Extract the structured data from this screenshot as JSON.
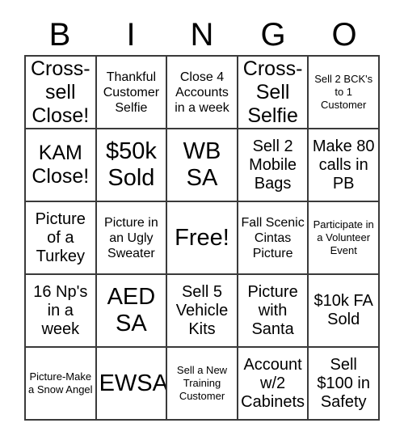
{
  "header": {
    "letters": [
      "B",
      "I",
      "N",
      "G",
      "O"
    ]
  },
  "grid": {
    "rows": [
      [
        {
          "text": "Cross-sell Close!",
          "size": "lg"
        },
        {
          "text": "Thankful Customer Selfie",
          "size": "sm"
        },
        {
          "text": "Close 4 Accounts in a week",
          "size": "sm"
        },
        {
          "text": "Cross-Sell Selfie",
          "size": "lg"
        },
        {
          "text": "Sell 2 BCK's to 1 Customer",
          "size": "xs"
        }
      ],
      [
        {
          "text": "KAM Close!",
          "size": "lg"
        },
        {
          "text": "$50k Sold",
          "size": "xl"
        },
        {
          "text": "WB SA",
          "size": "xl"
        },
        {
          "text": "Sell 2 Mobile Bags",
          "size": "md"
        },
        {
          "text": "Make 80 calls in PB",
          "size": "md"
        }
      ],
      [
        {
          "text": "Picture of a Turkey",
          "size": "md"
        },
        {
          "text": "Picture in an Ugly Sweater",
          "size": "sm"
        },
        {
          "text": "Free!",
          "size": "xl"
        },
        {
          "text": "Fall Scenic Cintas Picture",
          "size": "sm"
        },
        {
          "text": "Participate in a Volunteer Event",
          "size": "xs"
        }
      ],
      [
        {
          "text": "16 Np's in a week",
          "size": "md"
        },
        {
          "text": "AED SA",
          "size": "xl"
        },
        {
          "text": "Sell 5 Vehicle Kits",
          "size": "md"
        },
        {
          "text": "Picture with Santa",
          "size": "md"
        },
        {
          "text": "$10k FA Sold",
          "size": "md"
        }
      ],
      [
        {
          "text": "Picture-Make a Snow Angel",
          "size": "xs"
        },
        {
          "text": "EWSA",
          "size": "xl"
        },
        {
          "text": "Sell a New Training Customer",
          "size": "xs"
        },
        {
          "text": "Account w/2 Cabinets",
          "size": "md"
        },
        {
          "text": "Sell $100 in Safety",
          "size": "md"
        }
      ]
    ]
  },
  "colors": {
    "border": "#3a3a3a",
    "text": "#000000",
    "background": "#ffffff"
  }
}
